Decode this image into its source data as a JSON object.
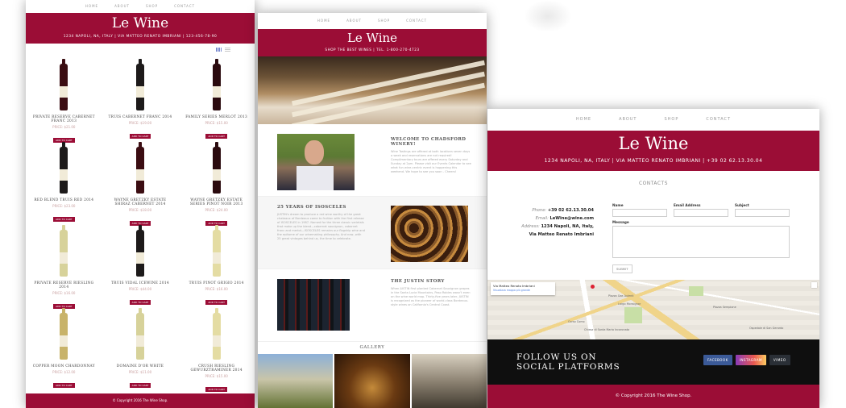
{
  "brand": {
    "name": "Le Wine",
    "color": "#9b0d36"
  },
  "nav": [
    "HOME",
    "ABOUT",
    "SHOP",
    "CONTACT"
  ],
  "shop_page": {
    "address": "1234 NAPOLI, NA, ITALY | VIA MATTEO RENATO IMBRIANI | 123-456-78-90",
    "add_to_cart": "ADD TO CART",
    "products": [
      {
        "name": "PRIVATE RESERVE CABERNET FRANC 2013",
        "price": "PRICE: $21.00"
      },
      {
        "name": "TRUIS CABERNET FRANC 2014",
        "price": "PRICE: $19.00"
      },
      {
        "name": "FAMILY SERIES MERLOT 2013",
        "price": "PRICE: $15.00"
      },
      {
        "name": "RED BLEND TRUIS RED 2014",
        "price": "PRICE: $23.00"
      },
      {
        "name": "WAYNE GRETZKY ESTATE SHIRAZ CABERNET 2014",
        "price": "PRICE: $18.00"
      },
      {
        "name": "WAYNE GRETZKY ESTATE SERIES PINOT NOIR 2013",
        "price": "PRICE: $24.00"
      },
      {
        "name": "PRIVATE RESERVE RIESLING 2014",
        "price": "PRICE: $16.00"
      },
      {
        "name": "TRUIS VIDAL ICEWINE 2014",
        "price": "PRICE: $44.00"
      },
      {
        "name": "TRUIS PINOT GRIGIO 2014",
        "price": "PRICE: $16.00"
      },
      {
        "name": "COPPER MOON CHARDONNAY",
        "price": "PRICE: $12.00"
      },
      {
        "name": "DOMAINE D'OR WHITE",
        "price": "PRICE: $11.00"
      },
      {
        "name": "CRUSH RIESLING GEWURZTRAMINER 2014",
        "price": "PRICE: $15.00"
      }
    ],
    "footer": "© Copyright 2016 The Wine Shop."
  },
  "about_page": {
    "tagline": "SHOP THE BEST WINES | TEL. 1-800-270-4723",
    "sections": [
      {
        "title": "WELCOME TO CHADSFORD WINERY!",
        "body": "Wine Tastings are offered at both locations seven days a week and reservations are not required! Complimentary tours are offered every Saturday and Sunday at 2pm. Please visit our Events Calendar to see what fun wine-centric event is happening this weekend. We hope to see you soon - Cheers!"
      },
      {
        "title": "25 YEARS OF ISOSCELES",
        "body": "JUSTIN's dream to produce a red wine worthy of the great chateaux of Bordeaux came to fruition with the first release of ISOSCELES in 1987. Named for the three classic varietals that make up the blend—cabernet sauvignon, cabernet franc and merlot—ISOSCELES remains our flagship wine and the epitome of our winemaking philosophy. And now, with 25 great vintages behind us, the time to celebrate."
      },
      {
        "title": "THE JUSTIN STORY",
        "body": "When JUSTIN first planted Cabernet Sauvignon grapes in the Santa Lucia Mountains, Paso Robles wasn't even on the wine world map. Thirty-five years later, JUSTIN is recognized as the pioneer of world-class Bordeaux-style wines on California's Central Coast."
      }
    ],
    "gallery_title": "GALLERY"
  },
  "contact_page": {
    "address": "1234 NAPOLI, NA, ITALY | VIA MATTEO RENATO IMBRIANI | +39 02 62.13.30.04",
    "section_title": "CONTACTS",
    "phone_label": "Phone:",
    "phone": "+39 02 62.13.30.04",
    "email_label": "Email:",
    "email": "LeWine@wine.com",
    "address_label": "Address:",
    "address_value": "1234 Napoli, NA, Italy, Via Matteo Renato Imbriani",
    "form": {
      "name_label": "Name",
      "email_label": "Email Address",
      "subject_label": "Subject",
      "message_label": "Message",
      "submit": "SUBMIT"
    },
    "map": {
      "popup_title": "Via Matteo Renato Imbriani",
      "popup_link": "Visualizza mappa più grande",
      "streets": [
        "Piazza Gae Aulenti",
        "Corso Como",
        "Largo Monsignor",
        "Piazza Sempione",
        "Chiesa di Santa Maria Incoronata",
        "Ospedale di San Gerardo"
      ]
    },
    "social_title": "FOLLOW US ON SOCIAL PLATFORMS",
    "social_buttons": [
      "FACEBOOK",
      "INSTAGRAM",
      "VIMEO"
    ],
    "footer": "© Copyright 2016 The Wine Shop."
  }
}
